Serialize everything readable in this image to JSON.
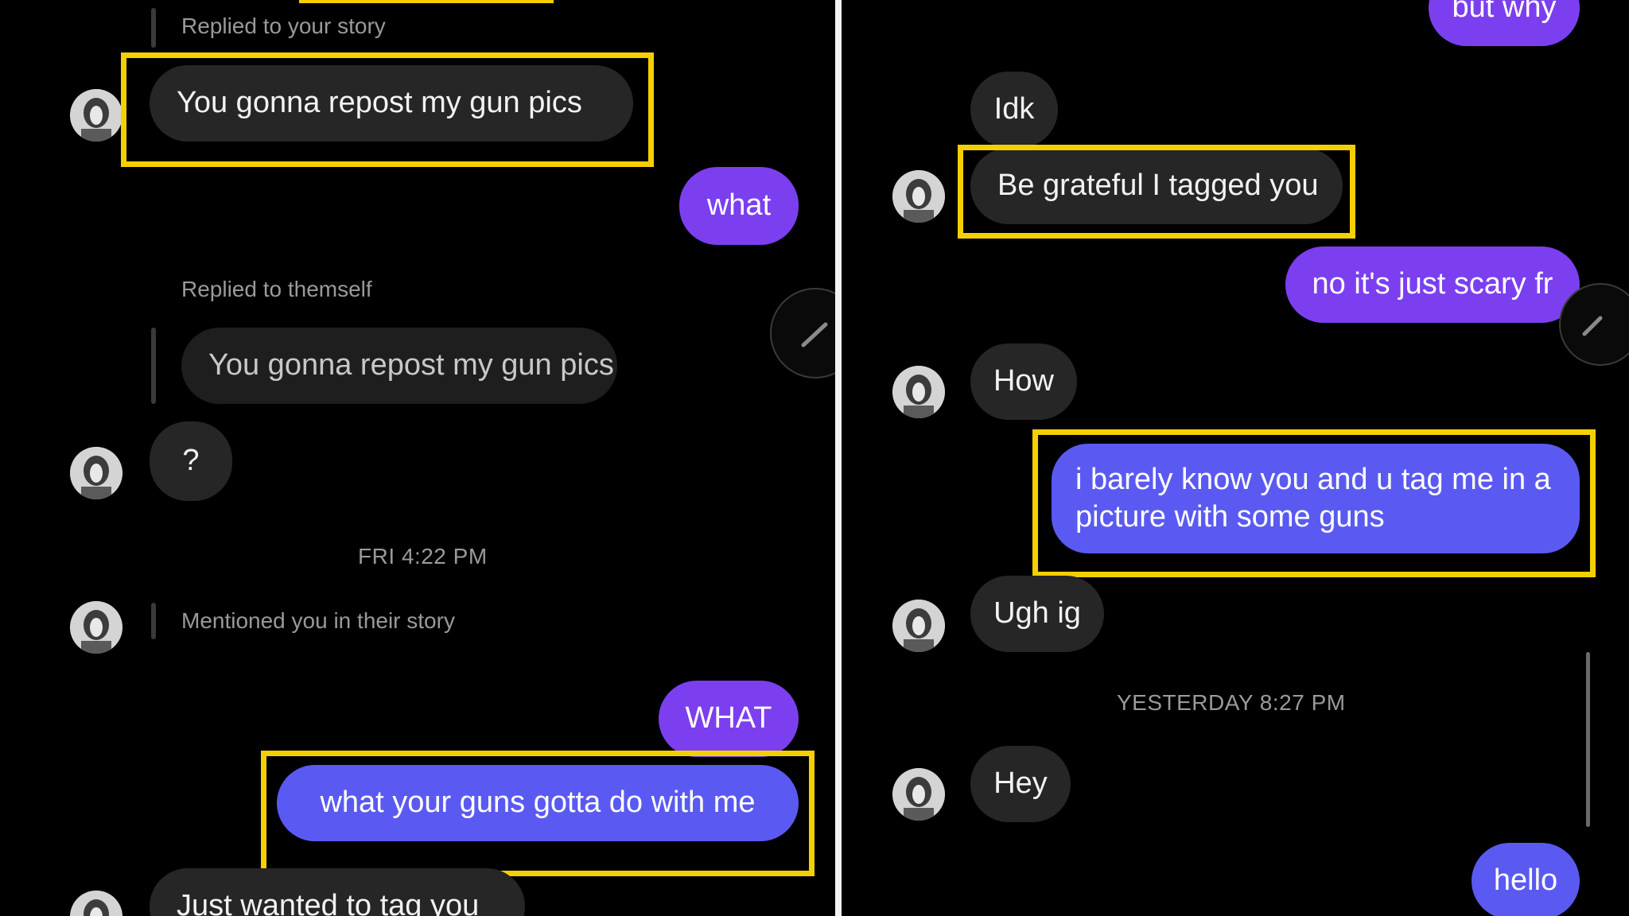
{
  "colors": {
    "background": "#000000",
    "incoming_bubble": "#262626",
    "outgoing_purple": "#7b3ff0",
    "outgoing_blue": "#5a5af2",
    "highlight": "#f5d000",
    "divider": "#f2f2f2"
  },
  "left": {
    "replied_story_label": "Replied to your story",
    "msg1": "You gonna repost my gun pics",
    "out_what": "what",
    "replied_themself_label": "Replied to themself",
    "quoted_msg": "You gonna repost my gun pics",
    "msg_question": "?",
    "timestamp": "FRI 4:22 PM",
    "mentioned_label": "Mentioned you in their story",
    "out_what_caps": "WHAT",
    "out_guns": "what your guns gotta do with me",
    "msg_tag": "Just wanted to tag you"
  },
  "right": {
    "out_but_why": "but why",
    "msg_idk": "Idk",
    "msg_grateful": "Be grateful I tagged you",
    "out_scary": "no it's just scary fr",
    "msg_how": "How",
    "out_barely": "i barely know you and u tag me in a picture with some guns",
    "msg_ugh": "Ugh ig",
    "timestamp": "YESTERDAY 8:27 PM",
    "msg_hey": "Hey",
    "out_hello": "hello"
  },
  "icons": {
    "avatar": "avatar-icon",
    "edit": "pencil-icon"
  }
}
